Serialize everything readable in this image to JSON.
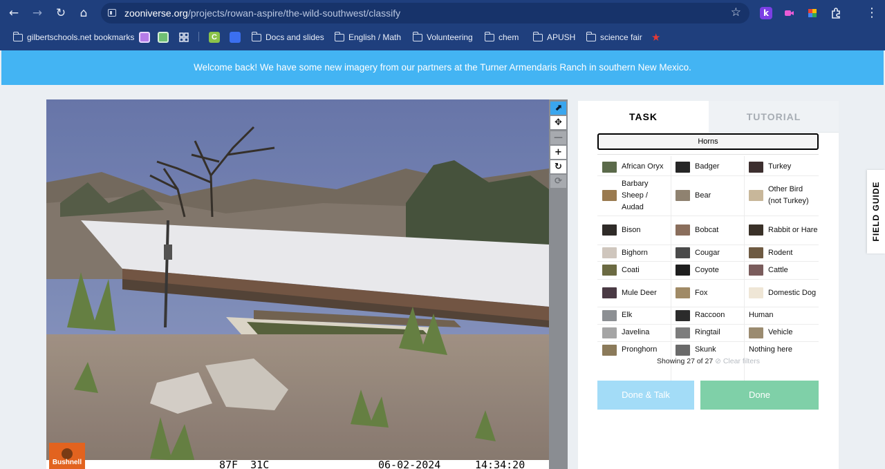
{
  "browser": {
    "url_host": "zooniverse.org",
    "url_path": "/projects/rowan-aspire/the-wild-southwest/classify",
    "extension_k_label": "k",
    "bookmarks": {
      "gilbert": "gilbertschools.net bookmarks",
      "c_label": "C",
      "folders": [
        "Docs and slides",
        "English / Math",
        "Volunteering",
        "chem",
        "APUSH",
        "science fair"
      ]
    }
  },
  "banner": {
    "text": "Welcome back! We have some new imagery from our partners at the Turner Armendaris Ranch in southern New Mexico."
  },
  "camera": {
    "brand": "Bushnell",
    "overlay": "87F  31C",
    "date": "06-02-2024",
    "time": "14:34:20"
  },
  "toolbar": {
    "icons": [
      "pointer-icon",
      "move-icon",
      "zoom-out-icon",
      "zoom-in-icon",
      "rotate-icon",
      "reset-icon"
    ]
  },
  "panel": {
    "tabs": {
      "task": "TASK",
      "tutorial": "TUTORIAL"
    },
    "filter": "Horns",
    "choices": [
      [
        "African Oryx",
        "Badger",
        "Turkey"
      ],
      [
        "Barbary Sheep / Audad",
        "Bear",
        "Other Bird (not Turkey)"
      ],
      [
        "Bison",
        "Bobcat",
        "Rabbit or Hare"
      ],
      [
        "Bighorn",
        "Cougar",
        "Rodent"
      ],
      [
        "Coati",
        "Coyote",
        "Cattle"
      ],
      [
        "Mule Deer",
        "Fox",
        "Domestic Dog"
      ],
      [
        "Elk",
        "Raccoon",
        "Human"
      ],
      [
        "Javelina",
        "Ringtail",
        "Vehicle"
      ],
      [
        "Pronghorn",
        "Skunk",
        "Nothing here"
      ]
    ],
    "showing": "Showing 27 of 27",
    "clear_filters": "Clear filters",
    "done_talk": "Done & Talk",
    "done": "Done"
  },
  "field_guide": {
    "label": "FIELD GUIDE"
  }
}
